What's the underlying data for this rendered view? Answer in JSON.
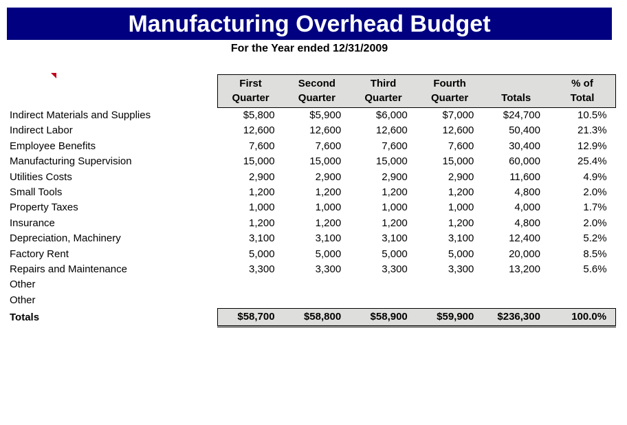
{
  "document": {
    "title": "Manufacturing Overhead Budget",
    "subtitle": "For the Year ended 12/31/2009",
    "banner_color": "#000080",
    "banner_text_color": "#ffffff",
    "header_fill_color": "#dededc",
    "comment_marker_color": "#c00018"
  },
  "table": {
    "columns": [
      {
        "line1": "",
        "line2": ""
      },
      {
        "line1": "First",
        "line2": "Quarter"
      },
      {
        "line1": "Second",
        "line2": "Quarter"
      },
      {
        "line1": "Third",
        "line2": "Quarter"
      },
      {
        "line1": "Fourth",
        "line2": "Quarter"
      },
      {
        "line1": "",
        "line2": "Totals"
      },
      {
        "line1": "% of",
        "line2": "Total"
      }
    ],
    "rows": [
      {
        "label": "Indirect Materials and Supplies",
        "q1": "$5,800",
        "q2": "$5,900",
        "q3": "$6,000",
        "q4": "$7,000",
        "total": "$24,700",
        "pct": "10.5%"
      },
      {
        "label": "Indirect Labor",
        "q1": "12,600",
        "q2": "12,600",
        "q3": "12,600",
        "q4": "12,600",
        "total": "50,400",
        "pct": "21.3%"
      },
      {
        "label": "Employee Benefits",
        "q1": "7,600",
        "q2": "7,600",
        "q3": "7,600",
        "q4": "7,600",
        "total": "30,400",
        "pct": "12.9%"
      },
      {
        "label": "Manufacturing Supervision",
        "q1": "15,000",
        "q2": "15,000",
        "q3": "15,000",
        "q4": "15,000",
        "total": "60,000",
        "pct": "25.4%"
      },
      {
        "label": "Utilities Costs",
        "q1": "2,900",
        "q2": "2,900",
        "q3": "2,900",
        "q4": "2,900",
        "total": "11,600",
        "pct": "4.9%"
      },
      {
        "label": "Small Tools",
        "q1": "1,200",
        "q2": "1,200",
        "q3": "1,200",
        "q4": "1,200",
        "total": "4,800",
        "pct": "2.0%"
      },
      {
        "label": "Property Taxes",
        "q1": "1,000",
        "q2": "1,000",
        "q3": "1,000",
        "q4": "1,000",
        "total": "4,000",
        "pct": "1.7%"
      },
      {
        "label": "Insurance",
        "q1": "1,200",
        "q2": "1,200",
        "q3": "1,200",
        "q4": "1,200",
        "total": "4,800",
        "pct": "2.0%"
      },
      {
        "label": "Depreciation, Machinery",
        "q1": "3,100",
        "q2": "3,100",
        "q3": "3,100",
        "q4": "3,100",
        "total": "12,400",
        "pct": "5.2%"
      },
      {
        "label": "Factory Rent",
        "q1": "5,000",
        "q2": "5,000",
        "q3": "5,000",
        "q4": "5,000",
        "total": "20,000",
        "pct": "8.5%"
      },
      {
        "label": "Repairs and Maintenance",
        "q1": "3,300",
        "q2": "3,300",
        "q3": "3,300",
        "q4": "3,300",
        "total": "13,200",
        "pct": "5.6%"
      },
      {
        "label": "Other",
        "q1": "",
        "q2": "",
        "q3": "",
        "q4": "",
        "total": "",
        "pct": ""
      },
      {
        "label": "Other",
        "q1": "",
        "q2": "",
        "q3": "",
        "q4": "",
        "total": "",
        "pct": ""
      }
    ],
    "totals_row": {
      "label": "Totals",
      "q1": "$58,700",
      "q2": "$58,800",
      "q3": "$58,900",
      "q4": "$59,900",
      "total": "$236,300",
      "pct": "100.0%"
    }
  }
}
